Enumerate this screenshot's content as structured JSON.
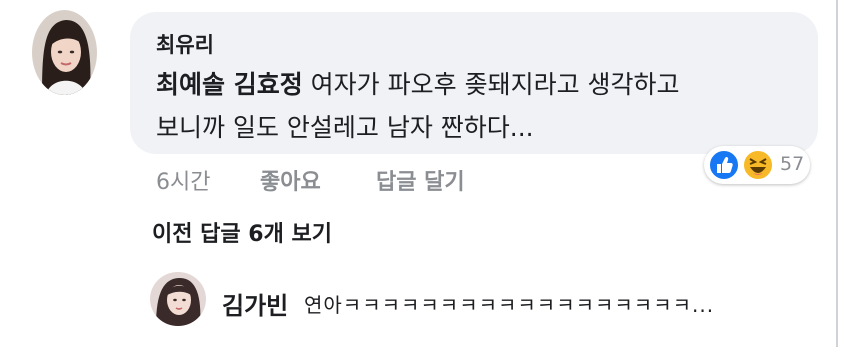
{
  "comment": {
    "author": "최유리",
    "mentions": "최예솔 김효정",
    "text_line1": "여자가 파오후 좆돼지라고 생각하고",
    "text_line2": "보니까 일도 안설레고 남자 짠하다...",
    "time": "6시간",
    "like_label": "좋아요",
    "reply_label": "답글 달기",
    "reaction_count": "57",
    "reaction_icons": [
      "like-icon",
      "haha-icon"
    ]
  },
  "thread": {
    "previous_replies_label": "이전 답글 6개 보기"
  },
  "reply": {
    "author": "김가빈",
    "text": "연아ㅋㅋㅋㅋㅋㅋㅋㅋㅋㅋㅋㅋㅋㅋㅋㅋㅋㅋ..."
  },
  "colors": {
    "bubble": "#f0f2f5",
    "meta_text": "#8a8d91",
    "like_blue": "#1877f2",
    "haha_yellow": "#f7b928"
  }
}
